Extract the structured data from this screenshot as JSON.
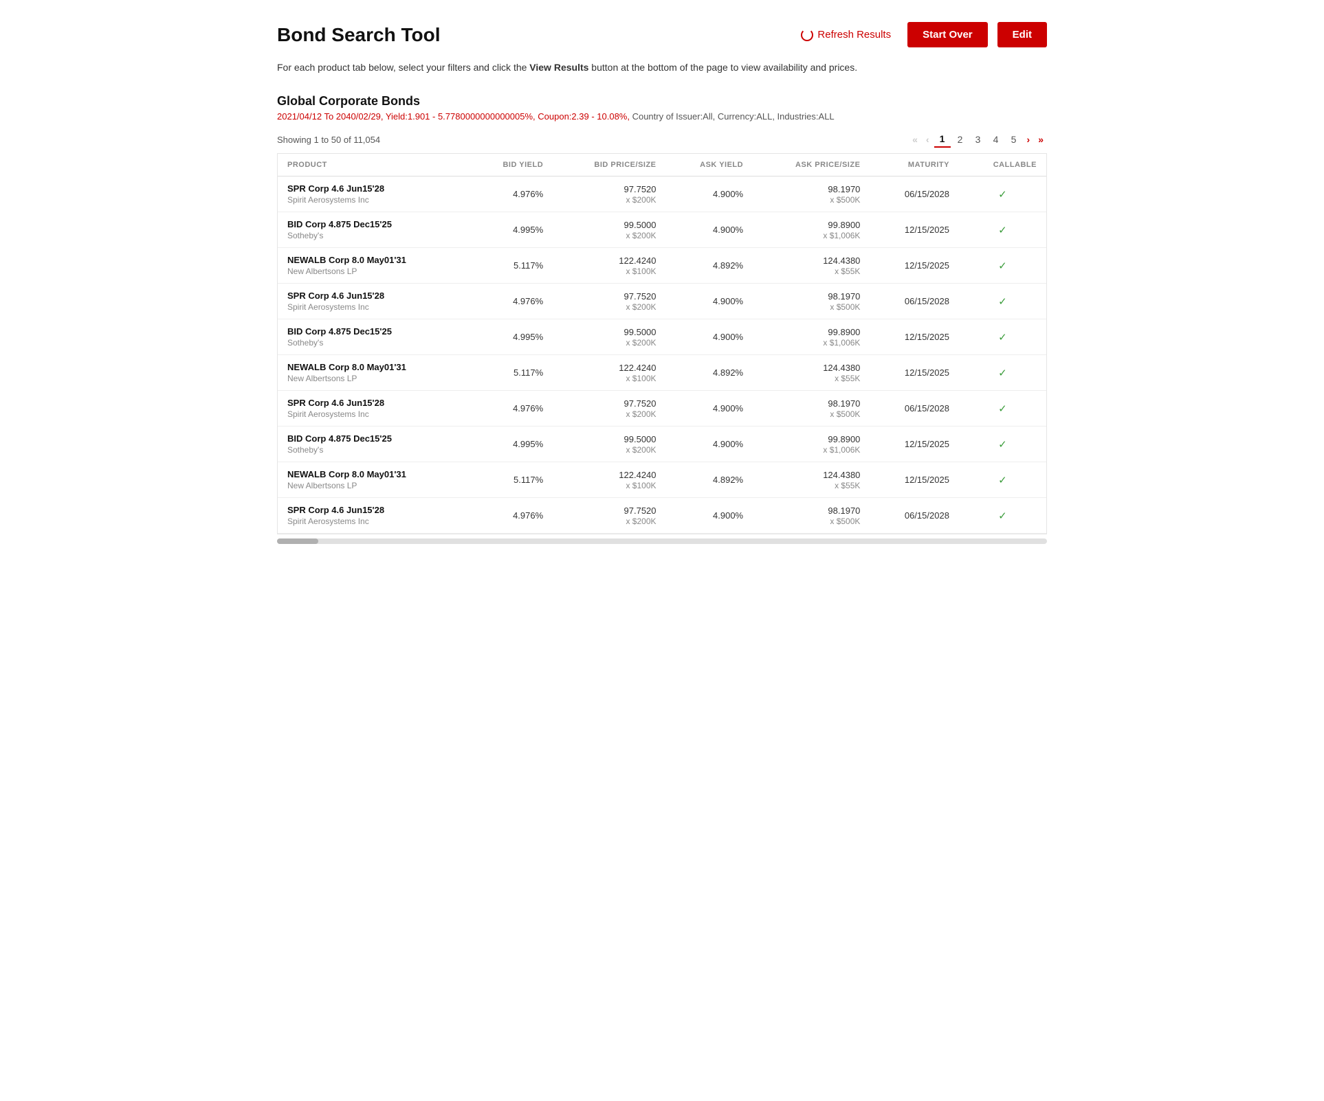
{
  "header": {
    "title": "Bond Search Tool",
    "refresh_label": "Refresh Results",
    "start_over_label": "Start Over",
    "edit_label": "Edit"
  },
  "subtitle": {
    "text_before": "For each product tab below, select your filters and click the ",
    "bold_text": "View Results",
    "text_after": " button at the bottom of the page to view availability and prices."
  },
  "section": {
    "title": "Global Corporate Bonds",
    "filter_summary": "2021/04/12 To 2040/02/29, Yield:1.901 - 5.7780000000000005%, Coupon:2.39 - 10.08%,",
    "filter_summary2": " Country of Issuer:All, Currency:ALL, Industries:ALL"
  },
  "results": {
    "showing": "Showing 1 to 50 of 11,054",
    "pages": [
      "1",
      "2",
      "3",
      "4",
      "5"
    ]
  },
  "columns": {
    "product": "PRODUCT",
    "bid_yield": "BID YIELD",
    "bid_price_size": "BID PRICE/SIZE",
    "ask_yield": "ASK YIELD",
    "ask_price_size": "ASK PRICE/SIZE",
    "maturity": "MATURITY",
    "callable": "CALLABLE"
  },
  "rows": [
    {
      "bond_name": "SPR Corp 4.6 Jun15'28",
      "issuer": "Spirit Aerosystems Inc",
      "bid_yield": "4.976%",
      "bid_price": "97.7520",
      "bid_size": "x $200K",
      "ask_yield": "4.900%",
      "ask_price": "98.1970",
      "ask_size": "x $500K",
      "maturity": "06/15/2028",
      "callable": true
    },
    {
      "bond_name": "BID Corp 4.875 Dec15'25",
      "issuer": "Sotheby's",
      "bid_yield": "4.995%",
      "bid_price": "99.5000",
      "bid_size": "x $200K",
      "ask_yield": "4.900%",
      "ask_price": "99.8900",
      "ask_size": "x $1,006K",
      "maturity": "12/15/2025",
      "callable": true
    },
    {
      "bond_name": "NEWALB Corp 8.0 May01'31",
      "issuer": "New Albertsons LP",
      "bid_yield": "5.117%",
      "bid_price": "122.4240",
      "bid_size": "x $100K",
      "ask_yield": "4.892%",
      "ask_price": "124.4380",
      "ask_size": "x $55K",
      "maturity": "12/15/2025",
      "callable": true
    },
    {
      "bond_name": "SPR Corp 4.6 Jun15'28",
      "issuer": "Spirit Aerosystems Inc",
      "bid_yield": "4.976%",
      "bid_price": "97.7520",
      "bid_size": "x $200K",
      "ask_yield": "4.900%",
      "ask_price": "98.1970",
      "ask_size": "x $500K",
      "maturity": "06/15/2028",
      "callable": true
    },
    {
      "bond_name": "BID Corp 4.875 Dec15'25",
      "issuer": "Sotheby's",
      "bid_yield": "4.995%",
      "bid_price": "99.5000",
      "bid_size": "x $200K",
      "ask_yield": "4.900%",
      "ask_price": "99.8900",
      "ask_size": "x $1,006K",
      "maturity": "12/15/2025",
      "callable": true
    },
    {
      "bond_name": "NEWALB Corp 8.0 May01'31",
      "issuer": "New Albertsons LP",
      "bid_yield": "5.117%",
      "bid_price": "122.4240",
      "bid_size": "x $100K",
      "ask_yield": "4.892%",
      "ask_price": "124.4380",
      "ask_size": "x $55K",
      "maturity": "12/15/2025",
      "callable": true
    },
    {
      "bond_name": "SPR Corp 4.6 Jun15'28",
      "issuer": "Spirit Aerosystems Inc",
      "bid_yield": "4.976%",
      "bid_price": "97.7520",
      "bid_size": "x $200K",
      "ask_yield": "4.900%",
      "ask_price": "98.1970",
      "ask_size": "x $500K",
      "maturity": "06/15/2028",
      "callable": true
    },
    {
      "bond_name": "BID Corp 4.875 Dec15'25",
      "issuer": "Sotheby's",
      "bid_yield": "4.995%",
      "bid_price": "99.5000",
      "bid_size": "x $200K",
      "ask_yield": "4.900%",
      "ask_price": "99.8900",
      "ask_size": "x $1,006K",
      "maturity": "12/15/2025",
      "callable": true
    },
    {
      "bond_name": "NEWALB Corp 8.0 May01'31",
      "issuer": "New Albertsons LP",
      "bid_yield": "5.117%",
      "bid_price": "122.4240",
      "bid_size": "x $100K",
      "ask_yield": "4.892%",
      "ask_price": "124.4380",
      "ask_size": "x $55K",
      "maturity": "12/15/2025",
      "callable": true
    },
    {
      "bond_name": "SPR Corp 4.6 Jun15'28",
      "issuer": "Spirit Aerosystems Inc",
      "bid_yield": "4.976%",
      "bid_price": "97.7520",
      "bid_size": "x $200K",
      "ask_yield": "4.900%",
      "ask_price": "98.1970",
      "ask_size": "x $500K",
      "maturity": "06/15/2028",
      "callable": true
    }
  ]
}
